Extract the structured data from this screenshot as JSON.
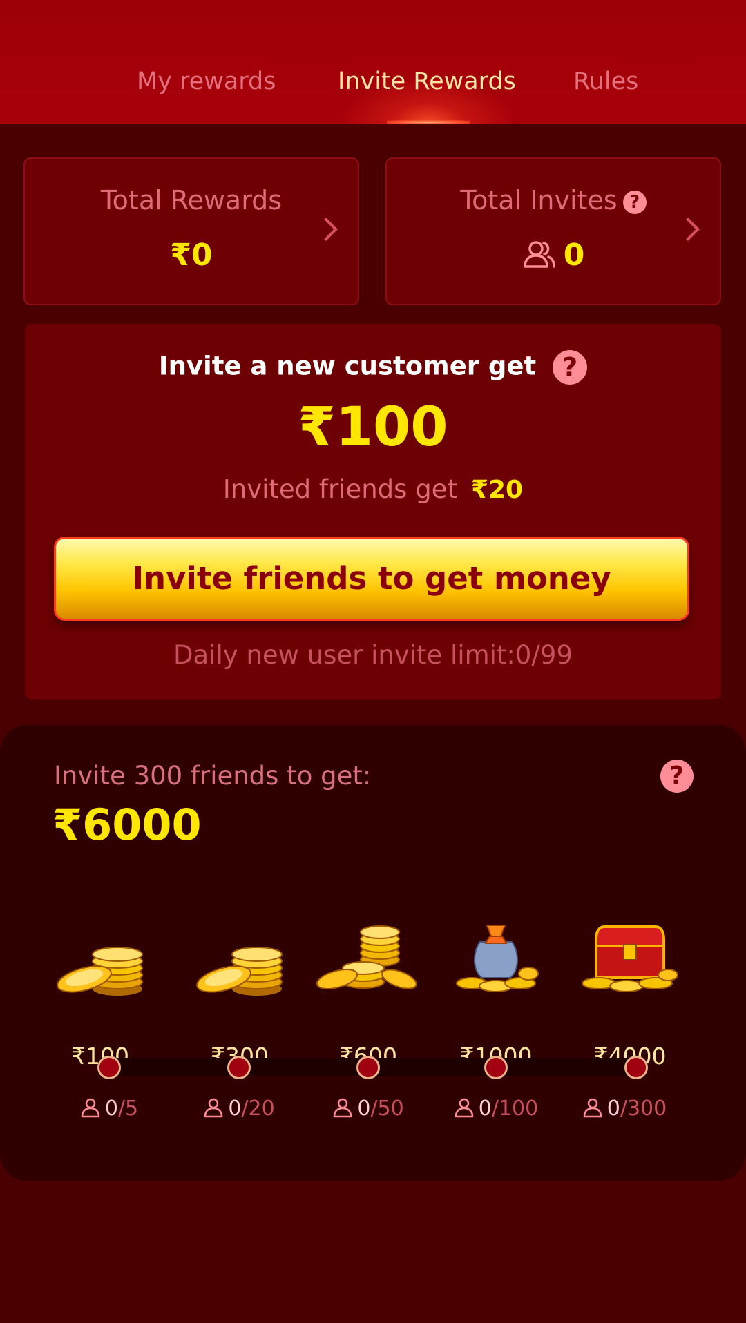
{
  "tabs": [
    {
      "label": "My rewards",
      "active": false
    },
    {
      "label": "Invite Rewards",
      "active": true
    },
    {
      "label": "Rules",
      "active": false
    }
  ],
  "stats": {
    "total_rewards": {
      "label": "Total Rewards",
      "value": "₹0"
    },
    "total_invites": {
      "label": "Total Invites",
      "value": "0"
    }
  },
  "invite": {
    "title": "Invite a new customer get",
    "amount": "₹100",
    "friends_text": "Invited friends get",
    "friends_amount": "₹20",
    "button_label": "Invite friends to get money",
    "limit_text": "Daily new user invite limit:0/99"
  },
  "milestones": {
    "title": "Invite 300 friends to get:",
    "amount": "₹6000",
    "tiers": [
      {
        "reward": "₹100",
        "current": "0",
        "target": "/5",
        "icon": "small-coin-stack-icon"
      },
      {
        "reward": "₹300",
        "current": "0",
        "target": "/20",
        "icon": "coin-stack-icon"
      },
      {
        "reward": "₹600",
        "current": "0",
        "target": "/50",
        "icon": "large-coin-pile-icon"
      },
      {
        "reward": "₹1000",
        "current": "0",
        "target": "/100",
        "icon": "money-bag-icon"
      },
      {
        "reward": "₹4000",
        "current": "0",
        "target": "/300",
        "icon": "treasure-chest-icon"
      }
    ]
  },
  "colors": {
    "accent": "#ffe600",
    "muted_text": "#e06b78",
    "header_bg": "#a00008",
    "page_bg": "#4a0000"
  }
}
